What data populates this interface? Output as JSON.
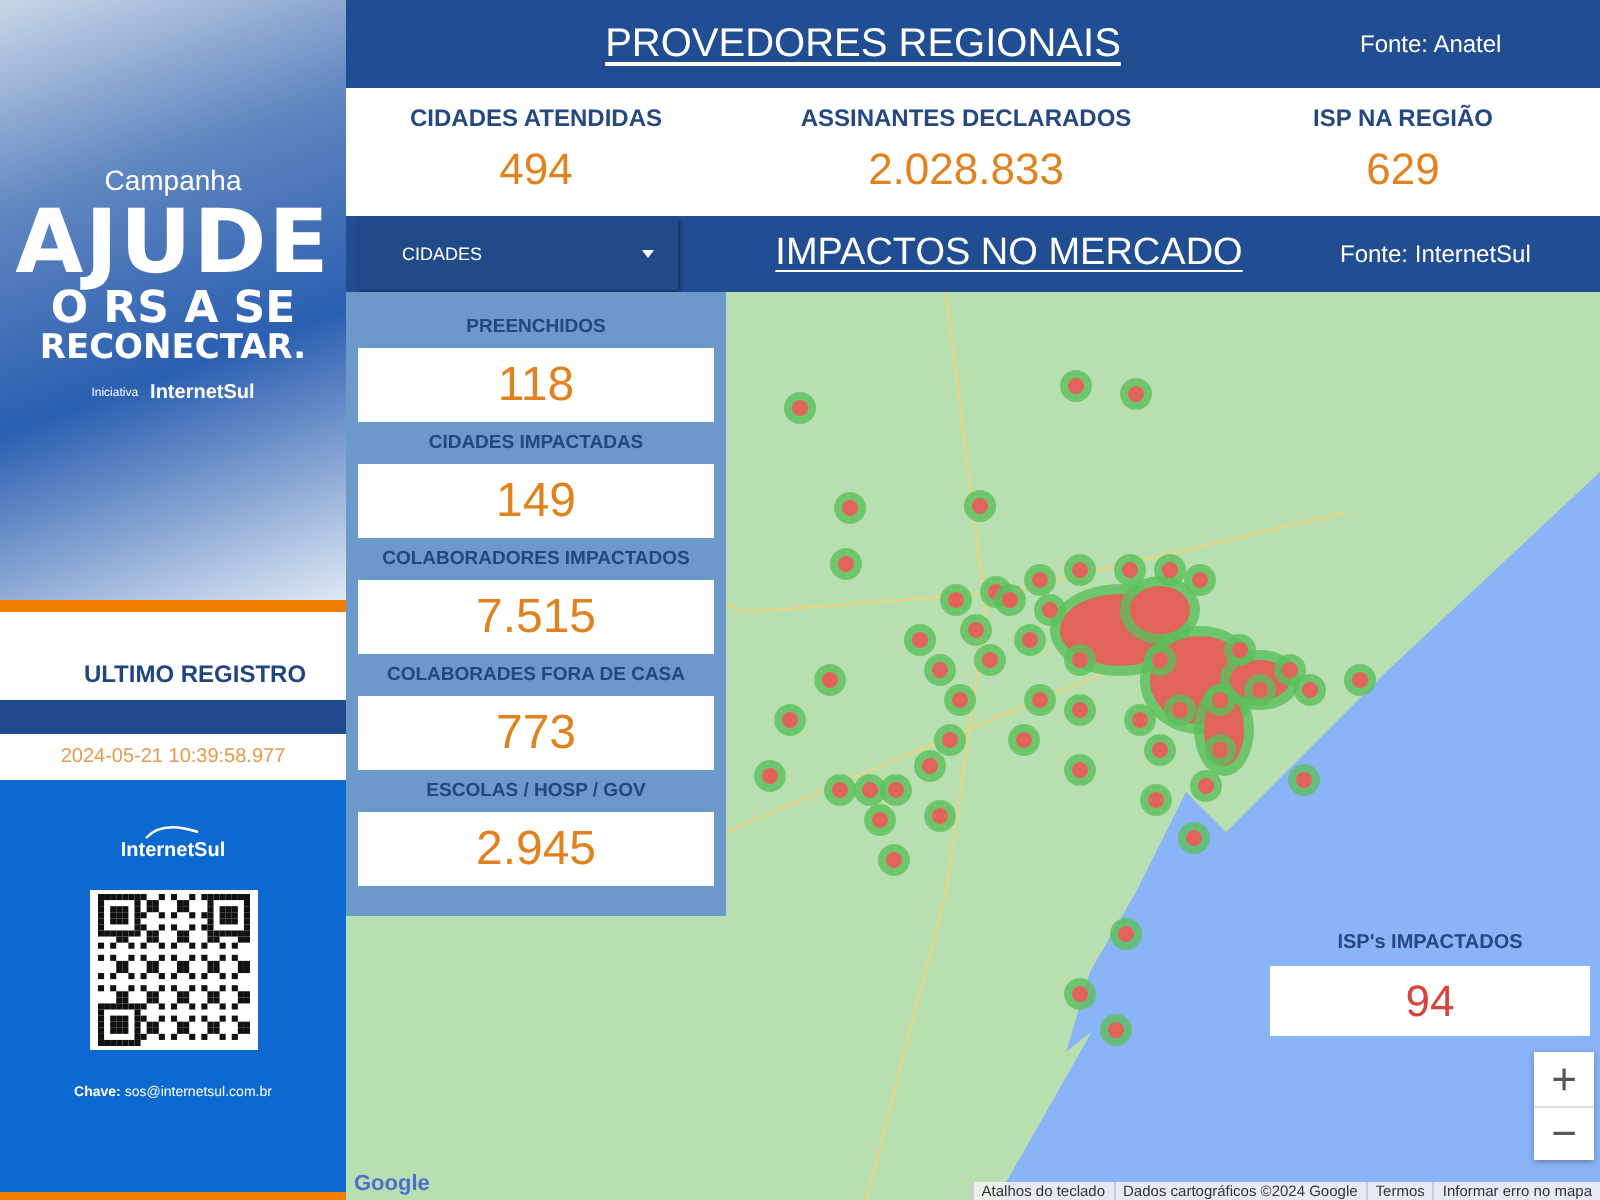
{
  "sidebar": {
    "campaign": {
      "eyebrow": "Campanha",
      "headline": [
        "AJUDE",
        "O RS A SE",
        "RECONECTAR."
      ],
      "initiative_label": "Iniciativa",
      "brand": "InternetSul"
    },
    "last_record": {
      "title": "ULTIMO REGISTRO",
      "timestamp": "2024-05-21 10:39:58.977"
    },
    "donation": {
      "brand": "InternetSul",
      "pix_key": "**Chave:** sos@internetsul.com.br"
    }
  },
  "header": {
    "title": "PROVEDORES REGIONAIS",
    "source": "Fonte: Anatel"
  },
  "summary": [
    {
      "label": "CIDADES ATENDIDAS",
      "value": "494"
    },
    {
      "label": "ASSINANTES DECLARADOS",
      "value": "2.028.833"
    },
    {
      "label": "ISP NA REGIÃO",
      "value": "629"
    }
  ],
  "market_bar": {
    "dropdown": "CIDADES",
    "title": "IMPACTOS NO MERCADO",
    "source": "Fonte: InternetSul"
  },
  "impact_metrics": [
    {
      "label": "PREENCHIDOS",
      "value": "118"
    },
    {
      "label": "CIDADES IMPACTADAS",
      "value": "149"
    },
    {
      "label": "COLABORADORES IMPACTADOS",
      "value": "7.515"
    },
    {
      "label": "COLABORADES FORA DE CASA",
      "value": "773"
    },
    {
      "label": "ESCOLAS / HOSP / GOV",
      "value": "2.945"
    }
  ],
  "isp_impacted": {
    "label": "ISP's IMPACTADOS",
    "value": "94"
  },
  "map": {
    "zoom_in": "+",
    "zoom_out": "−",
    "logo": "Google",
    "attribution": [
      "Atalhos do teclado",
      "Dados cartográficos ©2024 Google",
      "Termos",
      "Informar erro no mapa"
    ]
  }
}
